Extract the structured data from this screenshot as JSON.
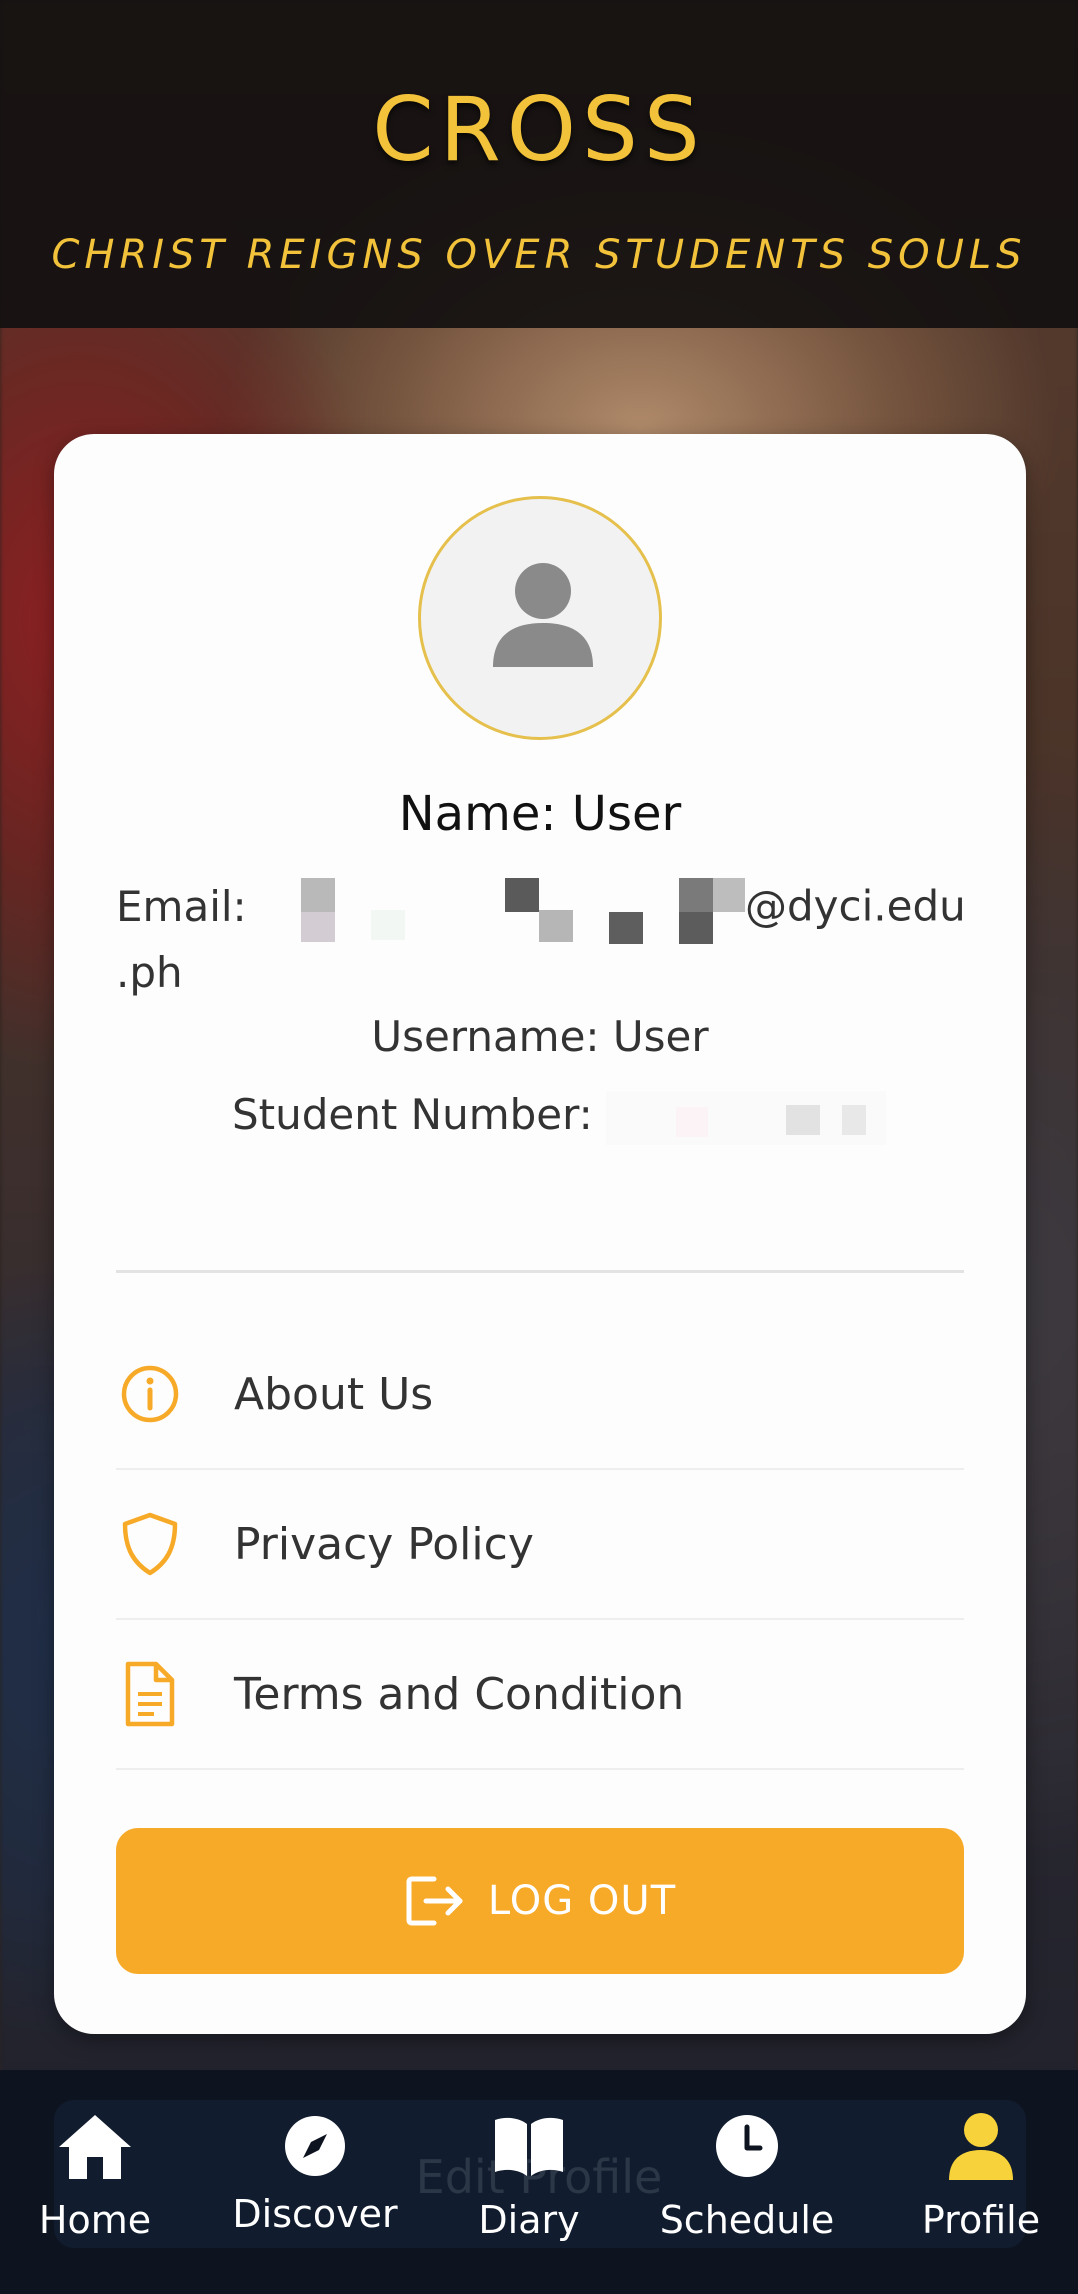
{
  "header": {
    "title": "CROSS",
    "subtitle": "CHRIST REIGNS OVER STUDENTS SOULS"
  },
  "profile": {
    "name": "Name: User",
    "email_label": "Email:",
    "email_domain": "@dyci.edu",
    "email_tail": ".ph",
    "username": "Username: User",
    "student_number_label": "Student Number:"
  },
  "menu": [
    {
      "label": "About Us",
      "icon": "info-icon"
    },
    {
      "label": "Privacy Policy",
      "icon": "shield-icon"
    },
    {
      "label": "Terms and Condition",
      "icon": "document-icon"
    }
  ],
  "logout_label": "LOG OUT",
  "edit_profile_label": "Edit Profile",
  "nav": [
    {
      "label": "Home",
      "icon": "home-icon"
    },
    {
      "label": "Discover",
      "icon": "compass-icon"
    },
    {
      "label": "Diary",
      "icon": "book-icon"
    },
    {
      "label": "Schedule",
      "icon": "clock-icon"
    },
    {
      "label": "Profile",
      "icon": "user-icon"
    }
  ],
  "colors": {
    "accent": "#f7a928",
    "title_gold": "#f2c23a",
    "nav_active": "#f7d23a",
    "nav_bg": "#0d1420"
  }
}
